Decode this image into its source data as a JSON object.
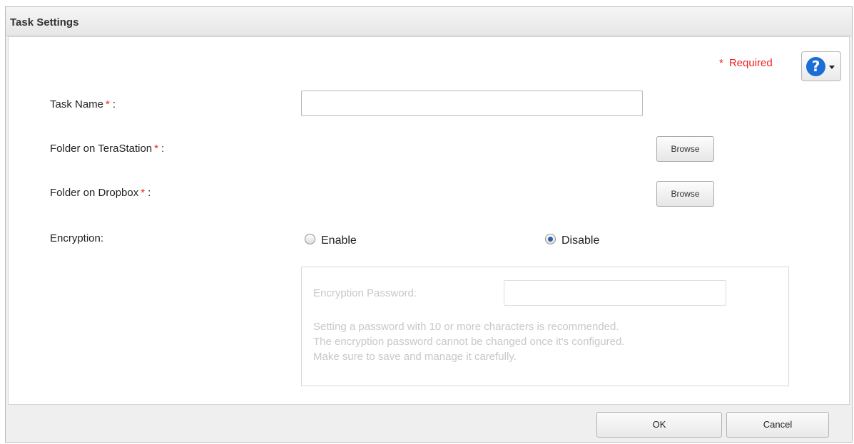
{
  "dialog": {
    "title": "Task Settings"
  },
  "required": {
    "star": "*",
    "label": "Required"
  },
  "help": {
    "icon": "?"
  },
  "form": {
    "task_name": {
      "label": "Task Name",
      "required_mark": "*",
      "suffix": ":",
      "value": ""
    },
    "folder_terastation": {
      "label": "Folder on TeraStation",
      "required_mark": "*",
      "suffix": ":",
      "button": "Browse"
    },
    "folder_dropbox": {
      "label": "Folder on Dropbox",
      "required_mark": "*",
      "suffix": ":",
      "button": "Browse"
    },
    "encryption": {
      "label": "Encryption:",
      "options": [
        "Enable",
        "Disable"
      ],
      "selected": "Disable"
    },
    "encryption_password": {
      "label": "Encryption Password:",
      "value": "",
      "disabled": true,
      "note_lines": [
        "Setting a password with 10 or more characters is recommended.",
        "The encryption password cannot be changed once it's configured.",
        "Make sure to save and manage it carefully."
      ]
    }
  },
  "footer": {
    "ok": "OK",
    "cancel": "Cancel"
  },
  "colors": {
    "required": "#ee2222",
    "help_icon": "#1b6ed6",
    "radio_selected": "#2d5fb0",
    "disabled_text": "#c8c8c8"
  }
}
